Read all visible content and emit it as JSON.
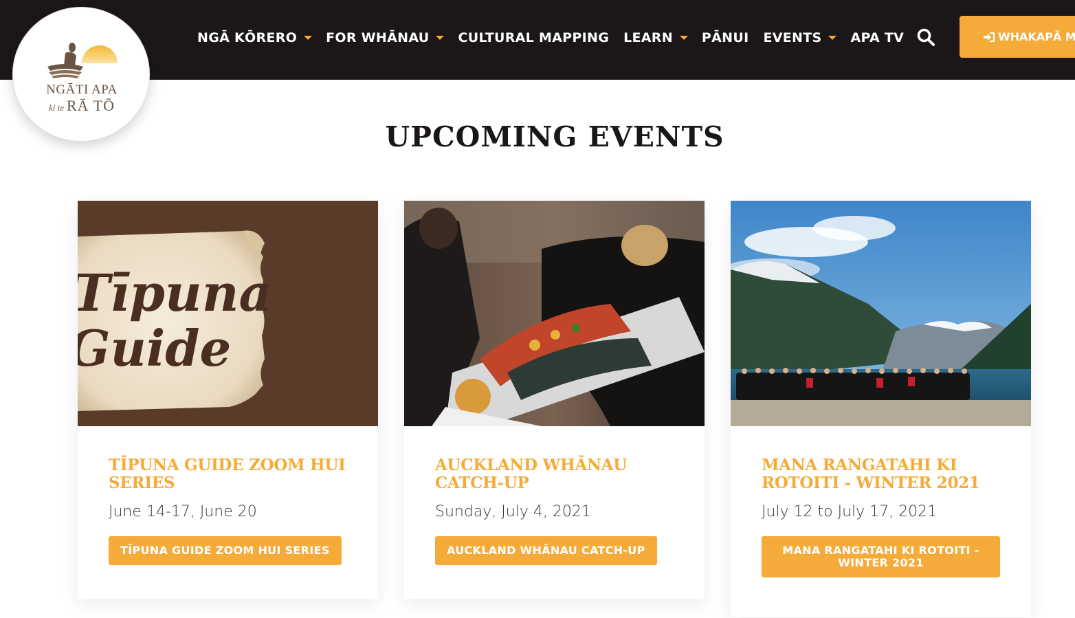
{
  "logo": {
    "line1": "NGĀTI APA",
    "line2_small": "ki te",
    "line2_big": "RĀ TŌ",
    "icon": "ngati-apa-logo"
  },
  "nav": {
    "items": [
      {
        "label": "NGĀ KŌRERO",
        "dropdown": true
      },
      {
        "label": "FOR WHĀNAU",
        "dropdown": true
      },
      {
        "label": "CULTURAL MAPPING",
        "dropdown": false
      },
      {
        "label": "LEARN",
        "dropdown": true
      },
      {
        "label": "PĀNUI",
        "dropdown": false
      },
      {
        "label": "EVENTS",
        "dropdown": true
      },
      {
        "label": "APA TV",
        "dropdown": false
      }
    ],
    "search_icon": "search-icon",
    "contact_label": "WHAKAPĀ MAI",
    "contact_icon": "sign-in-icon"
  },
  "section": {
    "title": "UPCOMING EVENTS"
  },
  "events": [
    {
      "title": "TĪPUNA GUIDE ZOOM HUI SERIES",
      "date": "June 14-17, June 20",
      "button": "TĪPUNA GUIDE ZOOM HUI SERIES",
      "image_text_1": "Tīpuna",
      "image_text_2": "Guide"
    },
    {
      "title": "AUCKLAND WHĀNAU CATCH-UP",
      "date": "Sunday, July 4, 2021",
      "button": "AUCKLAND WHĀNAU CATCH-UP"
    },
    {
      "title": "MANA RANGATAHI KI ROTOITI - WINTER 2021",
      "date": "July 12 to July 17, 2021",
      "button": "MANA RANGATAHI KI ROTOITI - WINTER 2021"
    }
  ],
  "colors": {
    "header_bg": "#1b1718",
    "accent": "#f5ab39",
    "text_dark": "#1b1718"
  }
}
